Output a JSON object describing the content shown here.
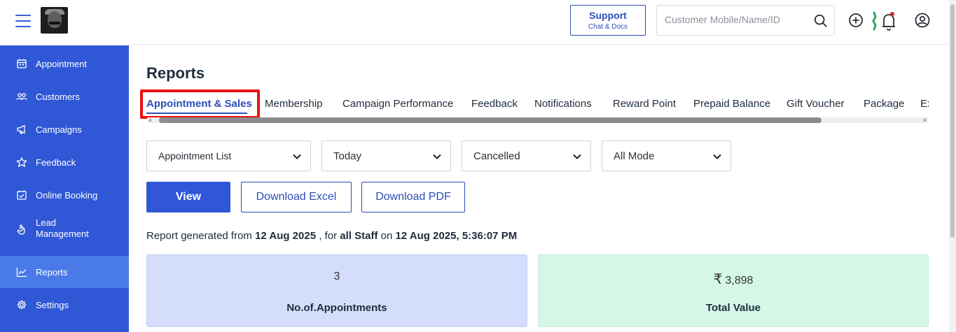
{
  "header": {
    "support_label": "Support",
    "support_sub": "Chat & Docs",
    "search_placeholder": "Customer Mobile/Name/ID"
  },
  "sidebar": {
    "items": [
      {
        "label": "Appointment",
        "icon": "calendar-icon"
      },
      {
        "label": "Customers",
        "icon": "users-icon"
      },
      {
        "label": "Campaigns",
        "icon": "megaphone-icon"
      },
      {
        "label": "Feedback",
        "icon": "star-icon"
      },
      {
        "label": "Online Booking",
        "icon": "calendar-check-icon"
      },
      {
        "label": "Lead\nManagement",
        "icon": "hand-icon"
      },
      {
        "label": "Reports",
        "icon": "chart-icon",
        "active": true
      },
      {
        "label": "Settings",
        "icon": "gear-icon"
      }
    ]
  },
  "main": {
    "title": "Reports",
    "tabs": [
      {
        "label": "Appointment & Sales",
        "active": true
      },
      {
        "label": "Membership"
      },
      {
        "label": "Campaign Performance"
      },
      {
        "label": "Feedback"
      },
      {
        "label": "Notifications"
      },
      {
        "label": "Reward Point"
      },
      {
        "label": "Prepaid Balance"
      },
      {
        "label": "Gift Voucher"
      },
      {
        "label": "Package"
      },
      {
        "label": "Ex"
      }
    ],
    "filters": {
      "report_type": "Appointment List",
      "period": "Today",
      "status": "Cancelled",
      "mode": "All Mode"
    },
    "buttons": {
      "view": "View",
      "download_excel": "Download Excel",
      "download_pdf": "Download PDF"
    },
    "report_line": {
      "prefix": "Report generated from ",
      "from_date": "12 Aug 2025",
      "mid": " , for ",
      "staff": "all Staff",
      "on": " on ",
      "generated_at": "12 Aug 2025, 5:36:07 PM"
    },
    "cards": {
      "appointments_value": "3",
      "appointments_label": "No.of.Appointments",
      "total_currency": "₹",
      "total_value": "3,898",
      "total_label": "Total Value"
    }
  },
  "colors": {
    "sidebar_bg": "#2f57d6",
    "sidebar_active": "#4a7ae8",
    "accent": "#2b4fb8",
    "highlight_red": "#ee1111",
    "card_blue": "#d4ddfb",
    "card_green": "#d5f7e7"
  }
}
